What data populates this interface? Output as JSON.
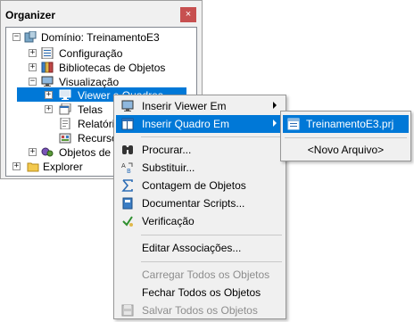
{
  "organizer": {
    "title": "Organizer",
    "close_glyph": "×",
    "tree": [
      {
        "label": "Domínio: TreinamentoE3",
        "icon": "domain-icon",
        "expander": "−"
      },
      {
        "label": "Configuração",
        "icon": "config-icon",
        "expander": "+"
      },
      {
        "label": "Bibliotecas de Objetos",
        "icon": "library-icon",
        "expander": "+"
      },
      {
        "label": "Visualização",
        "icon": "monitor-icon",
        "expander": "−"
      },
      {
        "label": "Viewer e Quadros",
        "icon": "viewer-icon",
        "expander": "+"
      },
      {
        "label": "Telas",
        "icon": "screens-icon",
        "expander": "+"
      },
      {
        "label": "Relatórios",
        "icon": "report-icon",
        "expander": ""
      },
      {
        "label": "Recursos",
        "icon": "resources-icon",
        "expander": ""
      },
      {
        "label": "Objetos de Servidor",
        "icon": "server-objects-icon",
        "expander": "+"
      },
      {
        "label": "Explorer",
        "icon": "folder-icon",
        "expander": "+"
      }
    ]
  },
  "context_menu": {
    "items": [
      {
        "label": "Inserir Viewer Em",
        "icon": "viewer-icon",
        "submenu": true
      },
      {
        "label": "Inserir Quadro Em",
        "icon": "frame-icon",
        "submenu": true
      },
      {
        "label": "Procurar...",
        "icon": "binoculars-icon"
      },
      {
        "label": "Substituir...",
        "icon": "replace-icon"
      },
      {
        "label": "Contagem de Objetos",
        "icon": "sigma-icon"
      },
      {
        "label": "Documentar Scripts...",
        "icon": "book-icon"
      },
      {
        "label": "Verificação",
        "icon": "check-icon"
      },
      {
        "label": "Editar Associações..."
      },
      {
        "label": "Carregar Todos os Objetos",
        "disabled": true
      },
      {
        "label": "Fechar Todos os Objetos"
      },
      {
        "label": "Salvar Todos os Objetos",
        "icon": "save-icon",
        "disabled": true
      }
    ]
  },
  "submenu": {
    "items": [
      {
        "label": "TreinamentoE3.prj",
        "icon": "project-icon"
      },
      {
        "label": "<Novo Arquivo>"
      }
    ]
  },
  "colors": {
    "selection": "#0078d7",
    "close": "#c75050",
    "disabled_text": "#8d8d8d"
  }
}
